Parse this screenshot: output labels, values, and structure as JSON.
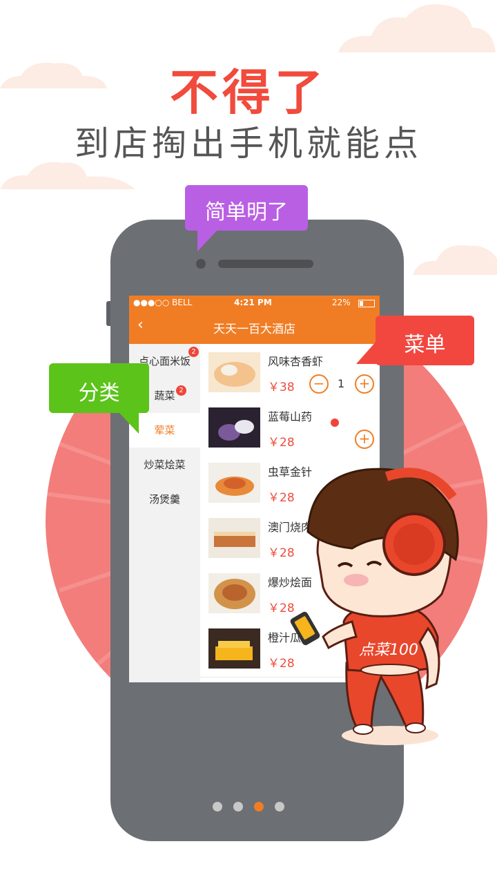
{
  "headline": {
    "title": "不得了",
    "subtitle": "到店掏出手机就能点"
  },
  "phone": {
    "status": {
      "carrier": "●●●○○ BELL",
      "time": "4:21 PM",
      "battery": "22%"
    },
    "nav": {
      "title": "天天一百大酒店",
      "back_icon": "‹"
    },
    "categories": [
      {
        "label": "点心面米饭",
        "badge": "2"
      },
      {
        "label": "蔬菜",
        "badge": "2"
      },
      {
        "label": "荤菜",
        "badge": ""
      },
      {
        "label": "炒菜烩菜",
        "badge": ""
      },
      {
        "label": "汤煲羹",
        "badge": ""
      }
    ],
    "dishes": [
      {
        "name": "风味杏香虾",
        "price": "￥38",
        "qty": "1"
      },
      {
        "name": "蓝莓山药",
        "price": "￥28"
      },
      {
        "name": "虫草金针",
        "price": "￥28"
      },
      {
        "name": "澳门烧肉",
        "price": "￥28"
      },
      {
        "name": "爆炒烩面",
        "price": "￥28"
      },
      {
        "name": "橙汁瓜条",
        "price": "￥28"
      }
    ]
  },
  "bubbles": {
    "simple": "简单明了",
    "menu": "菜单",
    "category": "分类"
  },
  "mascot": {
    "shirt_text": "点菜100"
  },
  "pager": {
    "count": 4,
    "active": 3
  },
  "colors": {
    "accent": "#f07d24",
    "title_red": "#f04b3c",
    "bubble_purple": "#b95fe4",
    "bubble_red": "#f2473f",
    "bubble_green": "#5bc31a"
  }
}
